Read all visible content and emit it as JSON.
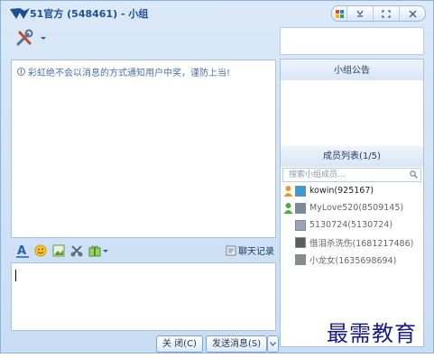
{
  "window": {
    "title": "51官方 (548461) - 小组"
  },
  "chat": {
    "notice": "彩虹绝不会以消息的方式通知用户中奖，谨防上当!",
    "history_label": "聊天记录"
  },
  "buttons": {
    "close_label": "关 闭(C)",
    "send_label": "发送消息(S)"
  },
  "panel": {
    "announcement_title": "小组公告",
    "members_title": "成员列表(1/5)",
    "search_placeholder": "搜索小组成员..."
  },
  "members": [
    {
      "name": "kowin(925167)",
      "online": true
    },
    {
      "name": "MyLove520(8509145)",
      "online": true
    },
    {
      "name": "5130724(5130724)",
      "online": false
    },
    {
      "name": "借泪杀洗伤(1681217486)",
      "online": false
    },
    {
      "name": "小龙女(1635698694)",
      "online": false
    }
  ],
  "watermark": "最需教育",
  "colors": {
    "accent": "#1d4f91",
    "window_bg": "#c9ddf3",
    "border": "#a9c4e3"
  }
}
